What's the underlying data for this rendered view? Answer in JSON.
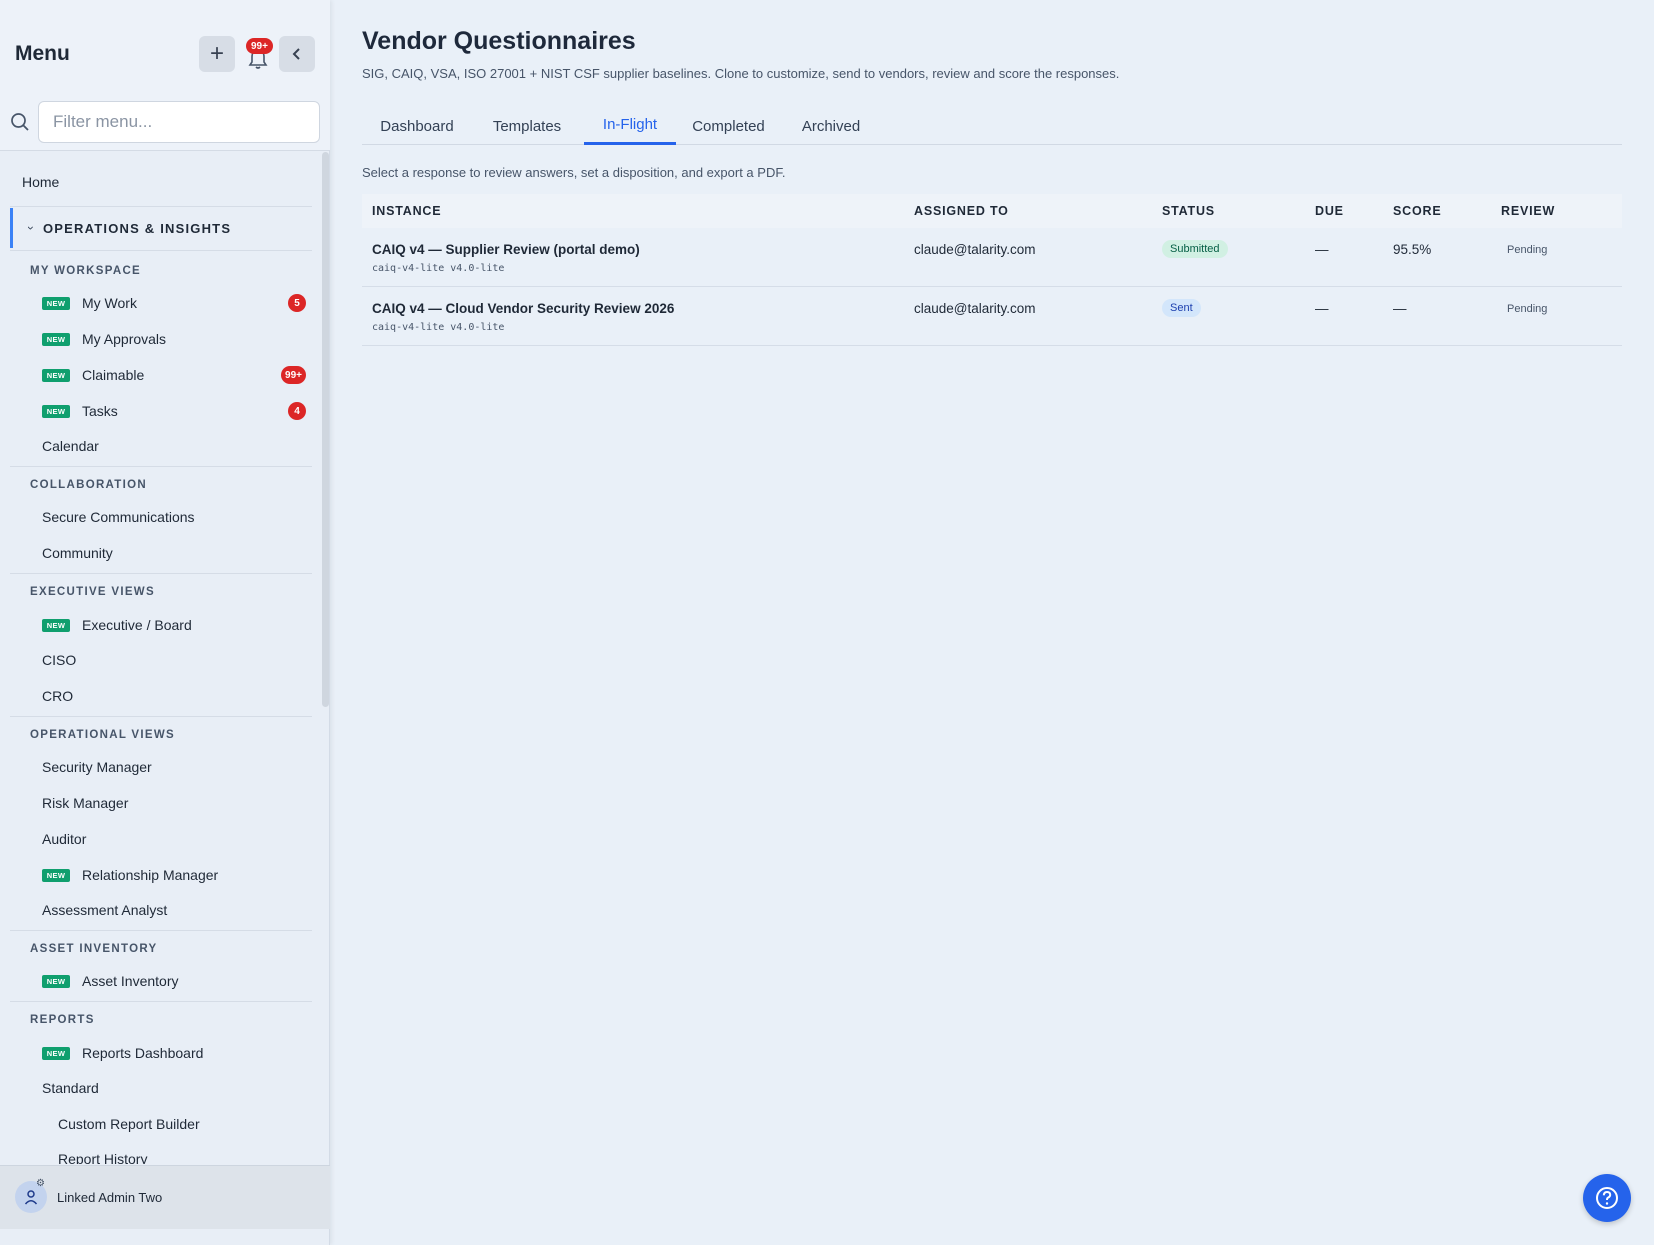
{
  "sidebar": {
    "title": "Menu",
    "notif_badge": "99+",
    "filter_placeholder": "Filter menu...",
    "home": "Home",
    "group": "OPERATIONS & INSIGHTS",
    "new_tag": "NEW",
    "sections": {
      "workspace": "MY WORKSPACE",
      "collaboration": "COLLABORATION",
      "executive": "EXECUTIVE VIEWS",
      "operational": "OPERATIONAL VIEWS",
      "asset": "ASSET INVENTORY",
      "reports": "REPORTS"
    },
    "items": {
      "my_work": "My Work",
      "my_work_count": "5",
      "my_approvals": "My Approvals",
      "claimable": "Claimable",
      "claimable_count": "99+",
      "tasks": "Tasks",
      "tasks_count": "4",
      "calendar": "Calendar",
      "secure_comms": "Secure Communications",
      "community": "Community",
      "exec_board": "Executive / Board",
      "ciso": "CISO",
      "cro": "CRO",
      "security_manager": "Security Manager",
      "risk_manager": "Risk Manager",
      "auditor": "Auditor",
      "relationship_manager": "Relationship Manager",
      "assessment_analyst": "Assessment Analyst",
      "asset_inventory": "Asset Inventory",
      "reports_dashboard": "Reports Dashboard",
      "standard": "Standard",
      "custom_report_builder": "Custom Report Builder",
      "report_history": "Report History"
    },
    "user": "Linked Admin Two"
  },
  "main": {
    "title": "Vendor Questionnaires",
    "subtitle": "SIG, CAIQ, VSA, ISO 27001 + NIST CSF supplier baselines. Clone to customize, send to vendors, review and score the responses.",
    "tabs": [
      "Dashboard",
      "Templates",
      "In-Flight",
      "Completed",
      "Archived"
    ],
    "active_tab": "In-Flight",
    "hint": "Select a response to review answers, set a disposition, and export a PDF.",
    "columns": [
      "INSTANCE",
      "ASSIGNED TO",
      "STATUS",
      "DUE",
      "SCORE",
      "REVIEW"
    ],
    "rows": [
      {
        "title": "CAIQ v4 — Supplier Review (portal demo)",
        "code": "caiq-v4-lite v4.0-lite",
        "assigned": "claude@talarity.com",
        "status": "Submitted",
        "due": "—",
        "score": "95.5%",
        "review": "Pending"
      },
      {
        "title": "CAIQ v4 — Cloud Vendor Security Review 2026",
        "code": "caiq-v4-lite v4.0-lite",
        "assigned": "claude@talarity.com",
        "status": "Sent",
        "due": "—",
        "score": "—",
        "review": "Pending"
      }
    ]
  },
  "icons": {
    "plus": "plus-icon",
    "bell": "bell-icon",
    "collapse": "chevron-left-icon",
    "search": "search-icon",
    "help": "help-icon",
    "user": "user-icon"
  },
  "colors": {
    "accent": "#2563eb",
    "new_tag": "#0f9f6e",
    "badge": "#dc2626"
  }
}
